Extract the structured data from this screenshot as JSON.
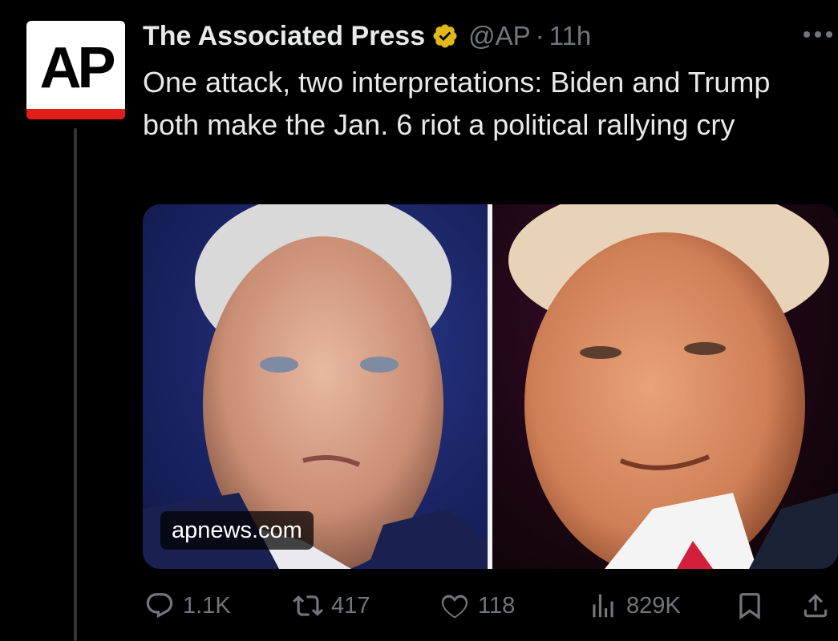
{
  "tweet": {
    "author_name": "The Associated Press",
    "handle": "@AP",
    "separator": "·",
    "time": "11h",
    "text": "One attack, two interpretations: Biden and Trump both make the Jan. 6 riot a political rallying cry",
    "avatar_logo_text": "AP",
    "link_domain": "apnews.com"
  },
  "metrics": {
    "replies": "1.1K",
    "reposts": "417",
    "likes": "118",
    "views": "829K"
  },
  "colors": {
    "background": "#000000",
    "text_primary": "#e7e9ea",
    "text_secondary": "#71767b",
    "verified_gold": "#e2b719",
    "ap_red": "#e31d1a"
  },
  "icons": {
    "verified": "gold-check-badge-icon",
    "more": "more-options-icon",
    "reply": "comment-icon",
    "repost": "repost-icon",
    "like": "heart-icon",
    "views": "views-chart-icon",
    "bookmark": "bookmark-icon",
    "share": "share-icon"
  }
}
